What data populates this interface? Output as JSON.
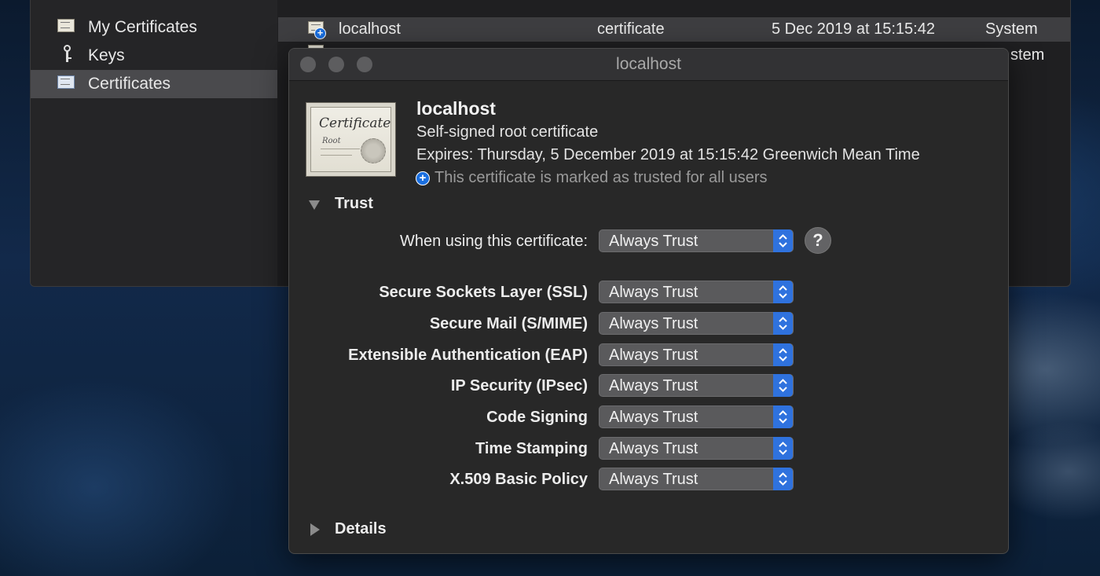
{
  "sidebar": {
    "items": [
      {
        "label": "My Certificates",
        "icon": "certificate-icon",
        "selected": false
      },
      {
        "label": "Keys",
        "icon": "key-icon",
        "selected": false
      },
      {
        "label": "Certificates",
        "icon": "certificate-icon",
        "selected": true
      }
    ]
  },
  "list": {
    "rows": [
      {
        "name": "localhost",
        "kind": "certificate",
        "expires": "5 Dec 2019 at 15:15:42",
        "keychain": "System",
        "selected": true
      },
      {
        "keychain_partial": "stem"
      }
    ]
  },
  "modal": {
    "title": "localhost",
    "cert_icon": {
      "line1": "Certificate",
      "line2": "Root"
    },
    "header": {
      "name": "localhost",
      "subtitle": "Self-signed root certificate",
      "expires": "Expires: Thursday, 5 December 2019 at 15:15:42 Greenwich Mean Time",
      "trusted_note": "This certificate is marked as trusted for all users"
    },
    "trust": {
      "section_label": "Trust",
      "expanded": true,
      "main": {
        "label": "When using this certificate:",
        "value": "Always Trust"
      },
      "help_label": "?",
      "policies": [
        {
          "label": "Secure Sockets Layer (SSL)",
          "value": "Always Trust"
        },
        {
          "label": "Secure Mail (S/MIME)",
          "value": "Always Trust"
        },
        {
          "label": "Extensible Authentication (EAP)",
          "value": "Always Trust"
        },
        {
          "label": "IP Security (IPsec)",
          "value": "Always Trust"
        },
        {
          "label": "Code Signing",
          "value": "Always Trust"
        },
        {
          "label": "Time Stamping",
          "value": "Always Trust"
        },
        {
          "label": "X.509 Basic Policy",
          "value": "Always Trust"
        }
      ]
    },
    "details": {
      "section_label": "Details",
      "expanded": false
    }
  },
  "colors": {
    "accent": "#2f72de",
    "badge": "#1a6fe0",
    "window_bg": "#282828"
  }
}
